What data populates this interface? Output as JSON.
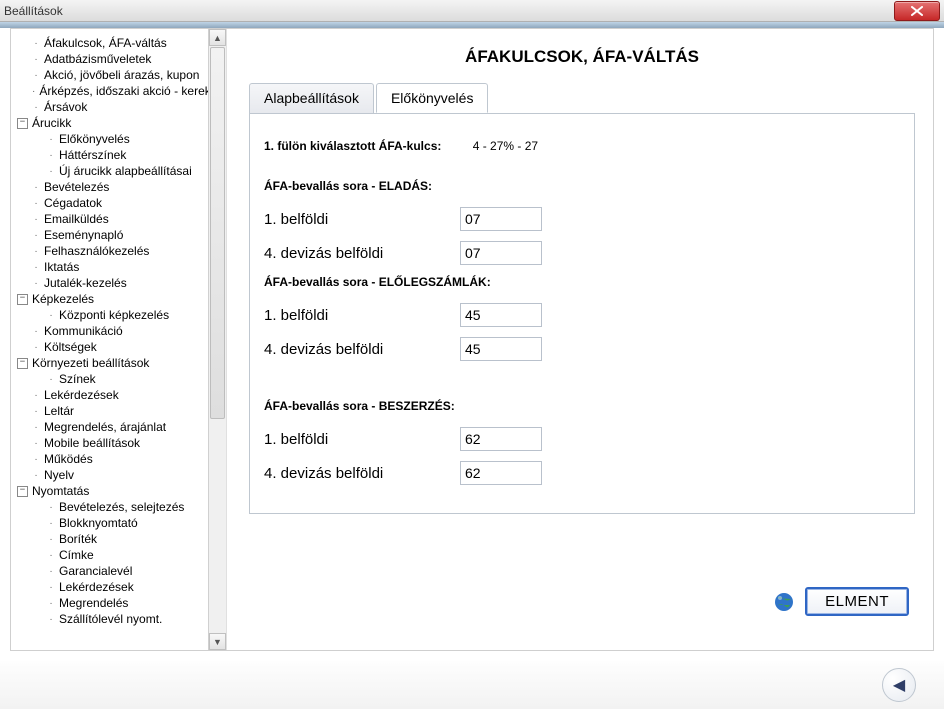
{
  "window": {
    "title": "Beállítások"
  },
  "tree": {
    "items": [
      {
        "label": "Áfakulcsok, ÁFA-váltás",
        "depth": 1
      },
      {
        "label": "Adatbázisműveletek",
        "depth": 1
      },
      {
        "label": "Akció, jövőbeli árazás, kupon",
        "depth": 1
      },
      {
        "label": "Árképzés, időszaki akció - kerekítés",
        "depth": 1
      },
      {
        "label": "Ársávok",
        "depth": 1
      },
      {
        "label": "Árucikk",
        "depth": 1,
        "expand": "minus"
      },
      {
        "label": "Előkönyvelés",
        "depth": 2
      },
      {
        "label": "Háttérszínek",
        "depth": 2
      },
      {
        "label": "Új árucikk alapbeállításai",
        "depth": 2
      },
      {
        "label": "Bevételezés",
        "depth": 1
      },
      {
        "label": "Cégadatok",
        "depth": 1
      },
      {
        "label": "Emailküldés",
        "depth": 1
      },
      {
        "label": "Eseménynapló",
        "depth": 1
      },
      {
        "label": "Felhasználókezelés",
        "depth": 1
      },
      {
        "label": "Iktatás",
        "depth": 1
      },
      {
        "label": "Jutalék-kezelés",
        "depth": 1
      },
      {
        "label": "Képkezelés",
        "depth": 1,
        "expand": "minus"
      },
      {
        "label": "Központi képkezelés",
        "depth": 2
      },
      {
        "label": "Kommunikáció",
        "depth": 1
      },
      {
        "label": "Költségek",
        "depth": 1
      },
      {
        "label": "Környezeti beállítások",
        "depth": 1,
        "expand": "minus"
      },
      {
        "label": "Színek",
        "depth": 2
      },
      {
        "label": "Lekérdezések",
        "depth": 1
      },
      {
        "label": "Leltár",
        "depth": 1
      },
      {
        "label": "Megrendelés, árajánlat",
        "depth": 1
      },
      {
        "label": "Mobile beállítások",
        "depth": 1
      },
      {
        "label": "Működés",
        "depth": 1
      },
      {
        "label": "Nyelv",
        "depth": 1
      },
      {
        "label": "Nyomtatás",
        "depth": 1,
        "expand": "minus"
      },
      {
        "label": "Bevételezés, selejtezés",
        "depth": 2
      },
      {
        "label": "Blokknyomtató",
        "depth": 2
      },
      {
        "label": "Boríték",
        "depth": 2
      },
      {
        "label": "Címke",
        "depth": 2
      },
      {
        "label": "Garancialevél",
        "depth": 2
      },
      {
        "label": "Lekérdezések",
        "depth": 2
      },
      {
        "label": "Megrendelés",
        "depth": 2
      },
      {
        "label": "Szállítólevél nyomt.",
        "depth": 2
      }
    ]
  },
  "main": {
    "heading": "ÁFAKULCSOK, ÁFA-VÁLTÁS",
    "tabs": {
      "basic": "Alapbeállítások",
      "preacc": "Előkönyvelés"
    },
    "top_label": "1. fülön kiválasztott ÁFA-kulcs:",
    "top_value": "4 - 27% - 27",
    "sections": {
      "eladas": {
        "title": "ÁFA-bevallás sora - ELADÁS:",
        "row1_label": "1. belföldi",
        "row1_value": "07",
        "row4_label": "4. devizás belföldi",
        "row4_value": "07"
      },
      "eloleg": {
        "title": "ÁFA-bevallás sora - ELŐLEGSZÁMLÁK:",
        "row1_label": "1. belföldi",
        "row1_value": "45",
        "row4_label": "4. devizás belföldi",
        "row4_value": "45"
      },
      "beszerzes": {
        "title": "ÁFA-bevallás sora - BESZERZÉS:",
        "row1_label": "1. belföldi",
        "row1_value": "62",
        "row4_label": "4. devizás belföldi",
        "row4_value": "62"
      }
    },
    "save_label": "ELMENT"
  }
}
